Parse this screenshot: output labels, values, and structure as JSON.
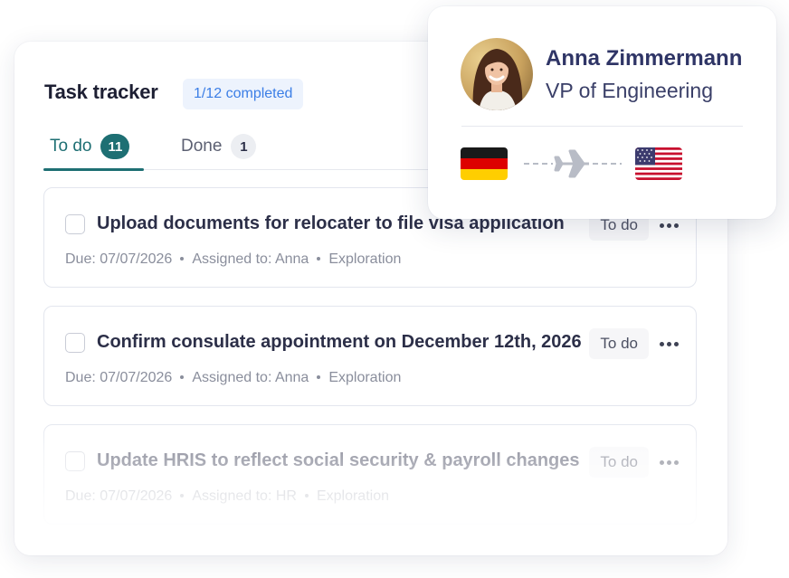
{
  "tracker": {
    "title": "Task tracker",
    "completed_badge": "1/12 completed",
    "tabs": [
      {
        "label": "To do",
        "count": "11",
        "active": true
      },
      {
        "label": "Done",
        "count": "1",
        "active": false
      }
    ],
    "tasks": [
      {
        "title": "Upload documents for relocater to file visa application",
        "status": "To do",
        "due": "Due: 07/07/2026",
        "assigned": "Assigned to: Anna",
        "category": "Exploration"
      },
      {
        "title": "Confirm consulate appointment on December 12th, 2026",
        "status": "To do",
        "due": "Due: 07/07/2026",
        "assigned": "Assigned to: Anna",
        "category": "Exploration"
      },
      {
        "title": "Update HRIS to reflect social security & payroll changes",
        "status": "To do",
        "due": "Due: 07/07/2026",
        "assigned": "Assigned to: HR",
        "category": "Exploration"
      }
    ]
  },
  "profile": {
    "name": "Anna Zimmermann",
    "role": "VP of Engineering",
    "origin_flag": "germany-flag",
    "destination_flag": "usa-flag",
    "route_icon": "airplane-icon"
  },
  "colors": {
    "accent_teal": "#1e6f73",
    "badge_blue": "#3b7ee6",
    "badge_bg": "#edf3fd",
    "name_navy": "#2f3566"
  }
}
